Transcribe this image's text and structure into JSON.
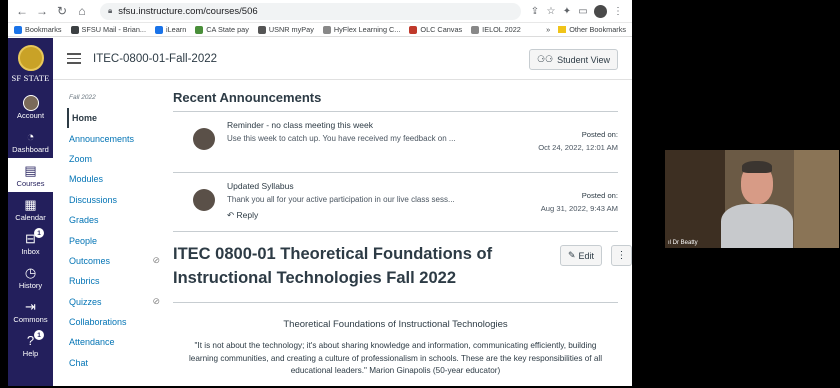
{
  "browser": {
    "url": "sfsu.instructure.com/courses/506",
    "bookmarks": [
      {
        "label": "Bookmarks",
        "color": "#1a73e8"
      },
      {
        "label": "SFSU Mail - Brian...",
        "color": "#3c4043"
      },
      {
        "label": "iLearn",
        "color": "#1a73e8"
      },
      {
        "label": "CA State pay",
        "color": "#4a8f3a"
      },
      {
        "label": "USNR myPay",
        "color": "#555555"
      },
      {
        "label": "HyFlex Learning C...",
        "color": "#888888"
      },
      {
        "label": "OLC Canvas",
        "color": "#c0392b"
      },
      {
        "label": "IELOL 2022",
        "color": "#888888"
      }
    ],
    "more_bookmarks": "»",
    "other_bookmarks": "Other Bookmarks"
  },
  "global_nav": {
    "logo_text": "SF STATE",
    "items": [
      {
        "label": "Account",
        "icon": "avatar"
      },
      {
        "label": "Dashboard",
        "icon": "dashboard-icon"
      },
      {
        "label": "Courses",
        "icon": "book-icon",
        "active": true
      },
      {
        "label": "Calendar",
        "icon": "calendar-icon"
      },
      {
        "label": "Inbox",
        "icon": "inbox-icon",
        "badge": "1"
      },
      {
        "label": "History",
        "icon": "clock-icon"
      },
      {
        "label": "Commons",
        "icon": "commons-icon"
      },
      {
        "label": "Help",
        "icon": "help-icon",
        "badge": "1"
      }
    ]
  },
  "course": {
    "breadcrumb": "ITEC-0800-01-Fall-2022",
    "student_view": "Student View",
    "term": "Fall 2022",
    "nav": [
      {
        "label": "Home",
        "active": true
      },
      {
        "label": "Announcements"
      },
      {
        "label": "Zoom"
      },
      {
        "label": "Modules"
      },
      {
        "label": "Discussions"
      },
      {
        "label": "Grades"
      },
      {
        "label": "People"
      },
      {
        "label": "Outcomes",
        "hidden": true
      },
      {
        "label": "Rubrics"
      },
      {
        "label": "Quizzes",
        "hidden": true
      },
      {
        "label": "Collaborations"
      },
      {
        "label": "Attendance"
      },
      {
        "label": "Chat"
      }
    ]
  },
  "recent": {
    "heading": "Recent Announcements",
    "items": [
      {
        "title": "Reminder - no class meeting this week",
        "message": "Use this week to catch up. You have received my feedback on ...",
        "posted_label": "Posted on:",
        "posted_date": "Oct 24, 2022, 12:01 AM"
      },
      {
        "title": "Updated Syllabus",
        "message": "Thank you all for your active participation in our live class sess...",
        "posted_label": "Posted on:",
        "posted_date": "Aug 31, 2022, 9:43 AM",
        "reply": "Reply"
      }
    ]
  },
  "front_page": {
    "title": "ITEC 0800-01 Theoretical Foundations of Instructional Technologies Fall 2022",
    "edit": "Edit",
    "subtitle": "Theoretical Foundations of Instructional Technologies",
    "quote": "\"It is not about the technology; it's about sharing knowledge and information, communicating efficiently, building learning communities, and creating a culture of professionalism in schools. These are the key responsibilities of all educational leaders.\" Marion Ginapolis (50-year educator)"
  },
  "video": {
    "name": "Dr Beatty"
  }
}
